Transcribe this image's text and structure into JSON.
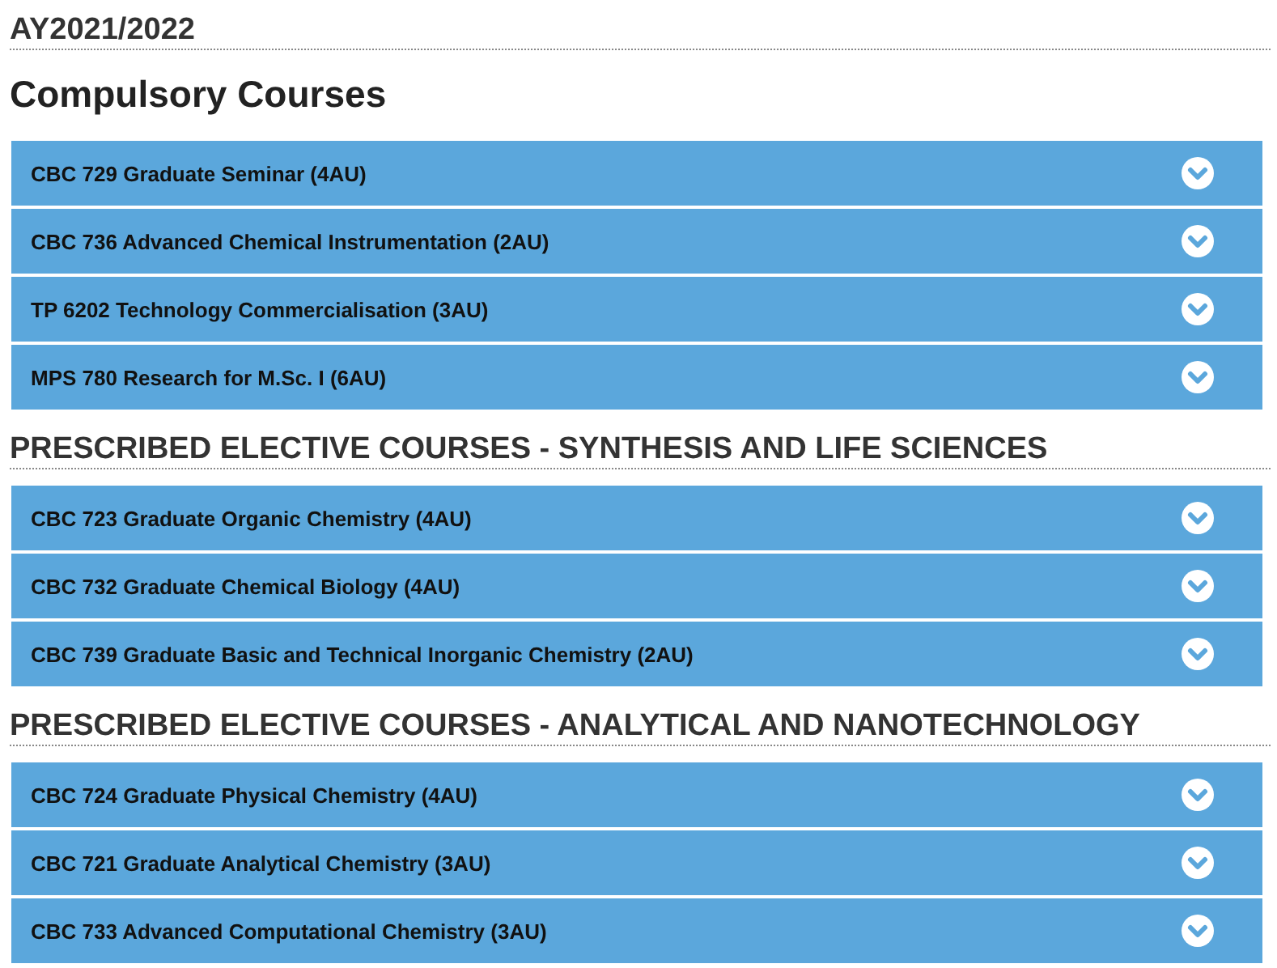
{
  "year": "AY2021/2022",
  "sections": [
    {
      "title": "Compulsory Courses",
      "kind": "main",
      "courses": [
        {
          "label": "CBC 729 Graduate Seminar (4AU)",
          "expanded": false
        },
        {
          "label": "CBC 736 Advanced Chemical Instrumentation (2AU)",
          "expanded": false
        },
        {
          "label": "TP 6202 Technology Commercialisation (3AU)",
          "expanded": false
        },
        {
          "label": "MPS 780 Research for M.Sc. I (6AU)",
          "expanded": false
        }
      ]
    },
    {
      "title": "PRESCRIBED ELECTIVE COURSES - SYNTHESIS AND LIFE SCIENCES",
      "kind": "elective",
      "courses": [
        {
          "label": "CBC 723 Graduate Organic Chemistry (4AU)",
          "expanded": false
        },
        {
          "label": "CBC 732 Graduate Chemical Biology (4AU)",
          "expanded": false
        },
        {
          "label": "CBC 739 Graduate Basic and Technical Inorganic Chemistry (2AU)",
          "expanded": false
        }
      ]
    },
    {
      "title": "PRESCRIBED ELECTIVE COURSES - ANALYTICAL AND NANOTECHNOLOGY",
      "kind": "elective",
      "courses": [
        {
          "label": "CBC 724 Graduate Physical Chemistry (4AU)",
          "expanded": false
        },
        {
          "label": "CBC 721 Graduate Analytical Chemistry (3AU)",
          "expanded": false
        },
        {
          "label": "CBC 733 Advanced Computational Chemistry (3AU)",
          "expanded": false
        }
      ]
    }
  ]
}
